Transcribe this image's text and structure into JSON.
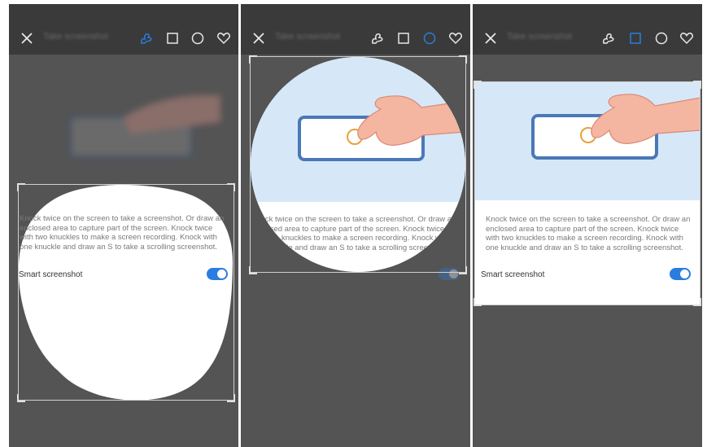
{
  "toolbar": {
    "title": "Take screenshot",
    "accent": "#2b7ce0",
    "icons": [
      "close-icon",
      "freeform-icon",
      "square-icon",
      "circle-icon",
      "heart-icon"
    ]
  },
  "content": {
    "description": "Knock twice on the screen to take a screenshot. Or draw an enclosed area to capture part of the screen. Knock twice with two knuckles to make a screen recording. Knock with one knuckle and draw an S to take a scrolling screenshot.",
    "smart_label": "Smart screenshot",
    "toggle_on": true
  },
  "panels": [
    {
      "mode": "freeform",
      "active_tool": "freeform-icon"
    },
    {
      "mode": "circle",
      "active_tool": "circle-icon"
    },
    {
      "mode": "square",
      "active_tool": "square-icon"
    }
  ]
}
